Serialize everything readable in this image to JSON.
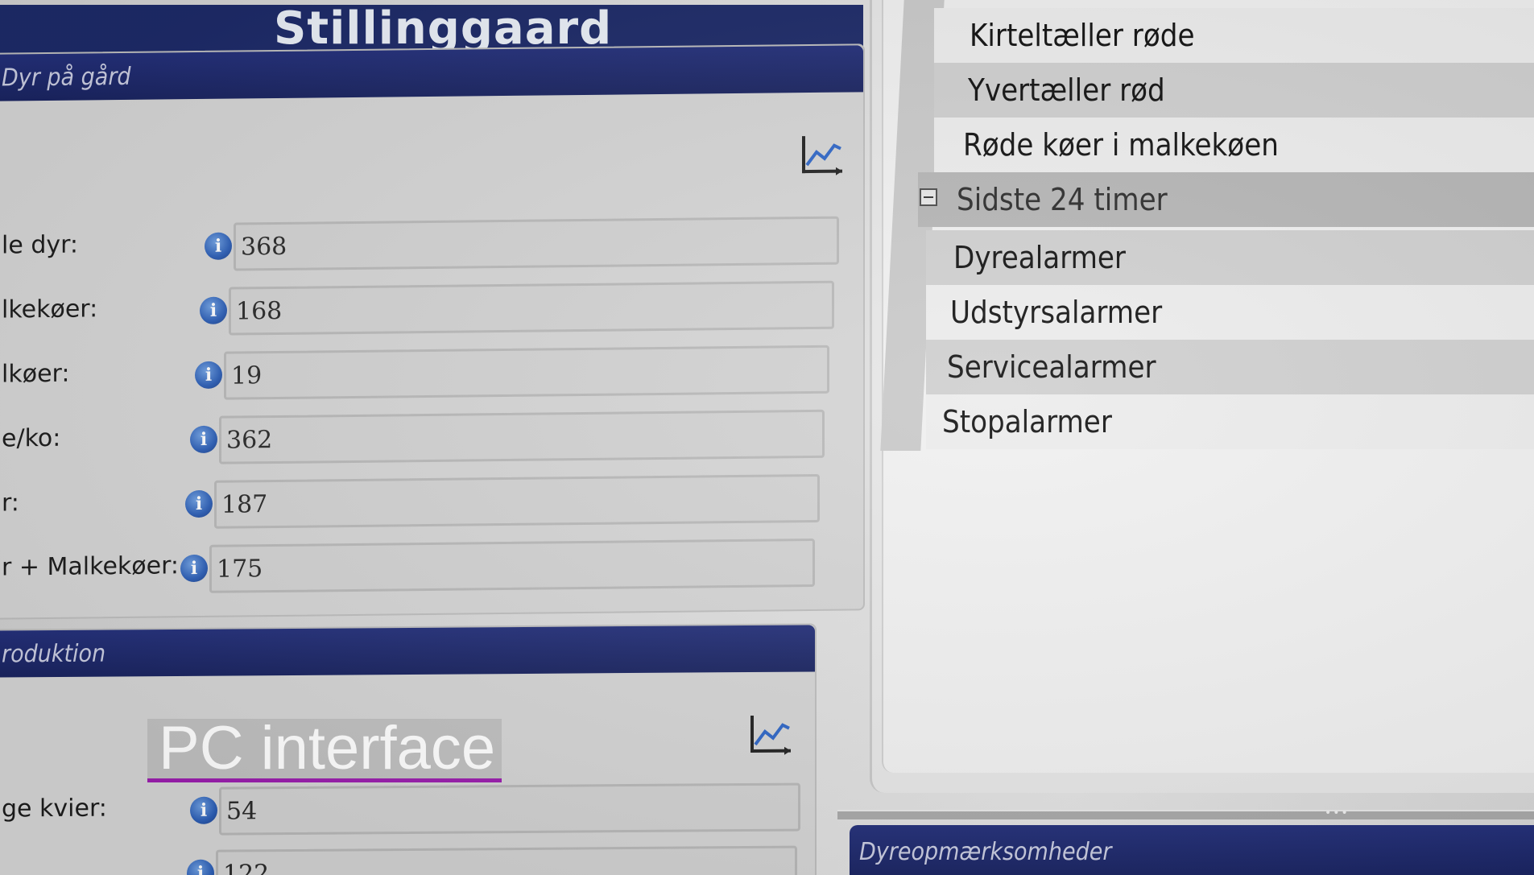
{
  "farm": {
    "title": "Stillinggaard"
  },
  "animals_panel": {
    "header": "Dyr på gård",
    "rows": [
      {
        "label": "le dyr:",
        "value": "368"
      },
      {
        "label": "lkekøer:",
        "value": "168"
      },
      {
        "label": "lkøer:",
        "value": "19"
      },
      {
        "label": "e/ko:",
        "value": "362"
      },
      {
        "label": "r:",
        "value": "187"
      },
      {
        "label": "r + Malkekøer:",
        "value": "175"
      }
    ]
  },
  "production_panel": {
    "header": "roduktion",
    "rows": [
      {
        "label": "ge kvier:",
        "value": "54"
      },
      {
        "label": "",
        "value": "122"
      }
    ]
  },
  "alarm_tree": {
    "items_top": [
      "Kirteltæller røde",
      "Yvertæller rød",
      "Røde køer i malkekøen"
    ],
    "group_label": "Sidste 24 timer",
    "items_group": [
      "Dyrealarmer",
      "Udstyrsalarmer",
      "Servicealarmer",
      "Stopalarmer"
    ]
  },
  "attention_panel": {
    "header": "Dyreopmærksomheder"
  },
  "caption": {
    "text": "PC interface",
    "underline_color": "#9b1fae"
  },
  "icons": {
    "chart": "line-chart-icon",
    "info": "info-icon",
    "collapse": "minus-box-icon"
  },
  "colors": {
    "header_bg": "#1d2a68",
    "info_icon": "#2d5fb6"
  }
}
